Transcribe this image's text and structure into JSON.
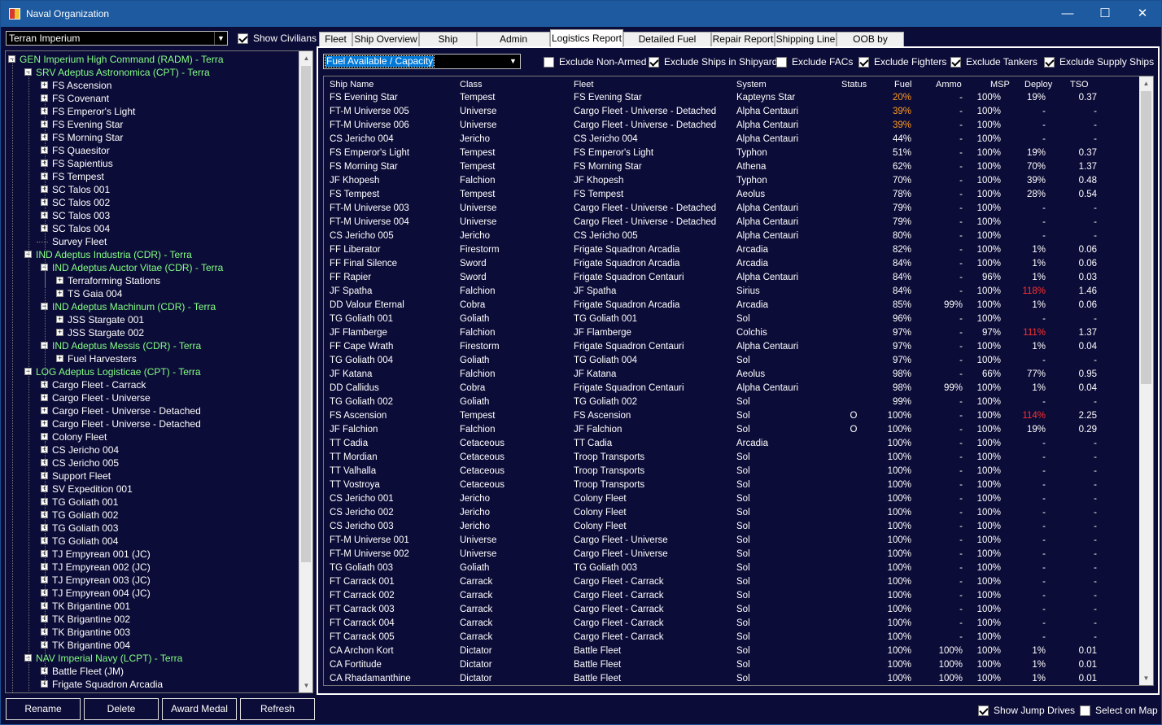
{
  "window": {
    "title": "Naval Organization",
    "minimize": "—",
    "maximize": "☐",
    "close": "✕"
  },
  "left": {
    "empire": "Terran Imperium",
    "show_civilians": {
      "label": "Show Civilians",
      "checked": true
    },
    "tree": [
      {
        "label": "GEN Imperium High Command  (RADM)  -  Terra",
        "lvl": 0,
        "green": true,
        "exp": "-"
      },
      {
        "label": "SRV Adeptus Astronomica  (CPT)  -  Terra",
        "lvl": 1,
        "green": true,
        "exp": "-"
      },
      {
        "label": "FS Ascension",
        "lvl": 2,
        "exp": "+"
      },
      {
        "label": "FS Covenant",
        "lvl": 2,
        "exp": "+"
      },
      {
        "label": "FS Emperor's Light",
        "lvl": 2,
        "exp": "+"
      },
      {
        "label": "FS Evening Star",
        "lvl": 2,
        "exp": "+"
      },
      {
        "label": "FS Morning Star",
        "lvl": 2,
        "exp": "+"
      },
      {
        "label": "FS Quaesitor",
        "lvl": 2,
        "exp": "+"
      },
      {
        "label": "FS Sapientius",
        "lvl": 2,
        "exp": "+"
      },
      {
        "label": "FS Tempest",
        "lvl": 2,
        "exp": "+"
      },
      {
        "label": "SC Talos 001",
        "lvl": 2,
        "exp": "+"
      },
      {
        "label": "SC Talos 002",
        "lvl": 2,
        "exp": "+"
      },
      {
        "label": "SC Talos 003",
        "lvl": 2,
        "exp": "+"
      },
      {
        "label": "SC Talos 004",
        "lvl": 2,
        "exp": "+"
      },
      {
        "label": "Survey Fleet",
        "lvl": 2,
        "exp": ""
      },
      {
        "label": "IND Adeptus Industria  (CDR)  -  Terra",
        "lvl": 1,
        "green": true,
        "exp": "-"
      },
      {
        "label": "IND Adeptus Auctor Vitae  (CDR)  -  Terra",
        "lvl": 2,
        "green": true,
        "exp": "-"
      },
      {
        "label": "Terraforming Stations",
        "lvl": 3,
        "exp": "+"
      },
      {
        "label": "TS Gaia 004",
        "lvl": 3,
        "exp": "+"
      },
      {
        "label": "IND Adeptus Machinum  (CDR)  -  Terra",
        "lvl": 2,
        "green": true,
        "exp": "-"
      },
      {
        "label": "JSS Stargate 001",
        "lvl": 3,
        "exp": "+"
      },
      {
        "label": "JSS Stargate 002",
        "lvl": 3,
        "exp": "+"
      },
      {
        "label": "IND Adeptus Messis  (CDR)  -  Terra",
        "lvl": 2,
        "green": true,
        "exp": "-"
      },
      {
        "label": "Fuel Harvesters",
        "lvl": 3,
        "exp": "+"
      },
      {
        "label": "LOG Adeptus Logisticae  (CPT)  -  Terra",
        "lvl": 1,
        "green": true,
        "exp": "-"
      },
      {
        "label": "Cargo Fleet - Carrack",
        "lvl": 2,
        "exp": "+"
      },
      {
        "label": "Cargo Fleet - Universe",
        "lvl": 2,
        "exp": "+"
      },
      {
        "label": "Cargo Fleet - Universe - Detached",
        "lvl": 2,
        "exp": "+"
      },
      {
        "label": "Cargo Fleet - Universe - Detached",
        "lvl": 2,
        "exp": "+"
      },
      {
        "label": "Colony Fleet",
        "lvl": 2,
        "exp": "+"
      },
      {
        "label": "CS Jericho 004",
        "lvl": 2,
        "exp": "+"
      },
      {
        "label": "CS Jericho 005",
        "lvl": 2,
        "exp": "+"
      },
      {
        "label": "Support Fleet",
        "lvl": 2,
        "exp": "+"
      },
      {
        "label": "SV Expedition 001",
        "lvl": 2,
        "exp": "+"
      },
      {
        "label": "TG Goliath 001",
        "lvl": 2,
        "exp": "+"
      },
      {
        "label": "TG Goliath 002",
        "lvl": 2,
        "exp": "+"
      },
      {
        "label": "TG Goliath 003",
        "lvl": 2,
        "exp": "+"
      },
      {
        "label": "TG Goliath 004",
        "lvl": 2,
        "exp": "+"
      },
      {
        "label": "TJ Empyrean 001  (JC)",
        "lvl": 2,
        "exp": "+"
      },
      {
        "label": "TJ Empyrean 002  (JC)",
        "lvl": 2,
        "exp": "+"
      },
      {
        "label": "TJ Empyrean 003  (JC)",
        "lvl": 2,
        "exp": "+"
      },
      {
        "label": "TJ Empyrean 004  (JC)",
        "lvl": 2,
        "exp": "+"
      },
      {
        "label": "TK Brigantine 001",
        "lvl": 2,
        "exp": "+"
      },
      {
        "label": "TK Brigantine 002",
        "lvl": 2,
        "exp": "+"
      },
      {
        "label": "TK Brigantine 003",
        "lvl": 2,
        "exp": "+"
      },
      {
        "label": "TK Brigantine 004",
        "lvl": 2,
        "exp": "+"
      },
      {
        "label": "NAV Imperial Navy  (LCPT)  -  Terra",
        "lvl": 1,
        "green": true,
        "exp": "-"
      },
      {
        "label": "Battle Fleet  (JM)",
        "lvl": 2,
        "exp": "+"
      },
      {
        "label": "Frigate Squadron Arcadia",
        "lvl": 2,
        "exp": "+"
      }
    ],
    "buttons": {
      "rename": "Rename",
      "delete": "Delete",
      "award": "Award Medal",
      "refresh": "Refresh"
    }
  },
  "tabs": [
    "Fleet",
    "Ship Overview",
    "Ship Combat",
    "Admin Command",
    "Logistics Report",
    "Detailed Fuel Report",
    "Repair Report",
    "Shipping Line",
    "OOB by System"
  ],
  "active_tab": "Logistics Report",
  "report": {
    "mode": "Fuel Available / Capacity",
    "filters": [
      {
        "label": "Exclude Non-Armed",
        "checked": false
      },
      {
        "label": "Exclude Ships in Shipyard",
        "checked": true
      },
      {
        "label": "Exclude FACs",
        "checked": false
      },
      {
        "label": "Exclude Fighters",
        "checked": true
      },
      {
        "label": "Exclude Tankers",
        "checked": true
      },
      {
        "label": "Exclude Supply Ships",
        "checked": true
      }
    ],
    "columns": [
      "Ship Name",
      "Class",
      "Fleet",
      "System",
      "Status",
      "Fuel",
      "Ammo",
      "MSP",
      "Deploy",
      "TSO"
    ],
    "rows": [
      [
        "FS Evening Star",
        "Tempest",
        "FS Evening Star",
        "Kapteyns Star",
        "",
        "20%",
        "-",
        "100%",
        "19%",
        "0.37"
      ],
      [
        "FT-M Universe 005",
        "Universe",
        "Cargo Fleet - Universe - Detached",
        "Alpha Centauri",
        "",
        "39%",
        "-",
        "100%",
        "-",
        "-"
      ],
      [
        "FT-M Universe 006",
        "Universe",
        "Cargo Fleet - Universe - Detached",
        "Alpha Centauri",
        "",
        "39%",
        "-",
        "100%",
        "-",
        "-"
      ],
      [
        "CS Jericho 004",
        "Jericho",
        "CS Jericho 004",
        "Alpha Centauri",
        "",
        "44%",
        "-",
        "100%",
        "-",
        "-"
      ],
      [
        "FS Emperor's Light",
        "Tempest",
        "FS Emperor's Light",
        "Typhon",
        "",
        "51%",
        "-",
        "100%",
        "19%",
        "0.37"
      ],
      [
        "FS Morning Star",
        "Tempest",
        "FS Morning Star",
        "Athena",
        "",
        "62%",
        "-",
        "100%",
        "70%",
        "1.37"
      ],
      [
        "JF Khopesh",
        "Falchion",
        "JF Khopesh",
        "Typhon",
        "",
        "70%",
        "-",
        "100%",
        "39%",
        "0.48"
      ],
      [
        "FS Tempest",
        "Tempest",
        "FS Tempest",
        "Aeolus",
        "",
        "78%",
        "-",
        "100%",
        "28%",
        "0.54"
      ],
      [
        "FT-M Universe 003",
        "Universe",
        "Cargo Fleet - Universe - Detached",
        "Alpha Centauri",
        "",
        "79%",
        "-",
        "100%",
        "-",
        "-"
      ],
      [
        "FT-M Universe 004",
        "Universe",
        "Cargo Fleet - Universe - Detached",
        "Alpha Centauri",
        "",
        "79%",
        "-",
        "100%",
        "-",
        "-"
      ],
      [
        "CS Jericho 005",
        "Jericho",
        "CS Jericho 005",
        "Alpha Centauri",
        "",
        "80%",
        "-",
        "100%",
        "-",
        "-"
      ],
      [
        "FF Liberator",
        "Firestorm",
        "Frigate Squadron Arcadia",
        "Arcadia",
        "",
        "82%",
        "-",
        "100%",
        "1%",
        "0.06"
      ],
      [
        "FF Final Silence",
        "Sword",
        "Frigate Squadron Arcadia",
        "Arcadia",
        "",
        "84%",
        "-",
        "100%",
        "1%",
        "0.06"
      ],
      [
        "FF Rapier",
        "Sword",
        "Frigate Squadron Centauri",
        "Alpha Centauri",
        "",
        "84%",
        "-",
        "96%",
        "1%",
        "0.03"
      ],
      [
        "JF Spatha",
        "Falchion",
        "JF Spatha",
        "Sirius",
        "",
        "84%",
        "-",
        "100%",
        "118%",
        "1.46"
      ],
      [
        "DD Valour Eternal",
        "Cobra",
        "Frigate Squadron Arcadia",
        "Arcadia",
        "",
        "85%",
        "99%",
        "100%",
        "1%",
        "0.06"
      ],
      [
        "TG Goliath 001",
        "Goliath",
        "TG Goliath 001",
        "Sol",
        "",
        "96%",
        "-",
        "100%",
        "-",
        "-"
      ],
      [
        "JF Flamberge",
        "Falchion",
        "JF Flamberge",
        "Colchis",
        "",
        "97%",
        "-",
        "97%",
        "111%",
        "1.37"
      ],
      [
        "FF Cape Wrath",
        "Firestorm",
        "Frigate Squadron Centauri",
        "Alpha Centauri",
        "",
        "97%",
        "-",
        "100%",
        "1%",
        "0.04"
      ],
      [
        "TG Goliath 004",
        "Goliath",
        "TG Goliath 004",
        "Sol",
        "",
        "97%",
        "-",
        "100%",
        "-",
        "-"
      ],
      [
        "JF Katana",
        "Falchion",
        "JF Katana",
        "Aeolus",
        "",
        "98%",
        "-",
        "66%",
        "77%",
        "0.95"
      ],
      [
        "DD Callidus",
        "Cobra",
        "Frigate Squadron Centauri",
        "Alpha Centauri",
        "",
        "98%",
        "99%",
        "100%",
        "1%",
        "0.04"
      ],
      [
        "TG Goliath 002",
        "Goliath",
        "TG Goliath 002",
        "Sol",
        "",
        "99%",
        "-",
        "100%",
        "-",
        "-"
      ],
      [
        "FS Ascension",
        "Tempest",
        "FS Ascension",
        "Sol",
        "O",
        "100%",
        "-",
        "100%",
        "114%",
        "2.25"
      ],
      [
        "JF Falchion",
        "Falchion",
        "JF Falchion",
        "Sol",
        "O",
        "100%",
        "-",
        "100%",
        "19%",
        "0.29"
      ],
      [
        "TT Cadia",
        "Cetaceous",
        "TT Cadia",
        "Arcadia",
        "",
        "100%",
        "-",
        "100%",
        "-",
        "-"
      ],
      [
        "TT Mordian",
        "Cetaceous",
        "Troop Transports",
        "Sol",
        "",
        "100%",
        "-",
        "100%",
        "-",
        "-"
      ],
      [
        "TT Valhalla",
        "Cetaceous",
        "Troop Transports",
        "Sol",
        "",
        "100%",
        "-",
        "100%",
        "-",
        "-"
      ],
      [
        "TT Vostroya",
        "Cetaceous",
        "Troop Transports",
        "Sol",
        "",
        "100%",
        "-",
        "100%",
        "-",
        "-"
      ],
      [
        "CS Jericho 001",
        "Jericho",
        "Colony Fleet",
        "Sol",
        "",
        "100%",
        "-",
        "100%",
        "-",
        "-"
      ],
      [
        "CS Jericho 002",
        "Jericho",
        "Colony Fleet",
        "Sol",
        "",
        "100%",
        "-",
        "100%",
        "-",
        "-"
      ],
      [
        "CS Jericho 003",
        "Jericho",
        "Colony Fleet",
        "Sol",
        "",
        "100%",
        "-",
        "100%",
        "-",
        "-"
      ],
      [
        "FT-M Universe 001",
        "Universe",
        "Cargo Fleet - Universe",
        "Sol",
        "",
        "100%",
        "-",
        "100%",
        "-",
        "-"
      ],
      [
        "FT-M Universe 002",
        "Universe",
        "Cargo Fleet - Universe",
        "Sol",
        "",
        "100%",
        "-",
        "100%",
        "-",
        "-"
      ],
      [
        "TG Goliath 003",
        "Goliath",
        "TG Goliath 003",
        "Sol",
        "",
        "100%",
        "-",
        "100%",
        "-",
        "-"
      ],
      [
        "FT Carrack 001",
        "Carrack",
        "Cargo Fleet - Carrack",
        "Sol",
        "",
        "100%",
        "-",
        "100%",
        "-",
        "-"
      ],
      [
        "FT Carrack 002",
        "Carrack",
        "Cargo Fleet - Carrack",
        "Sol",
        "",
        "100%",
        "-",
        "100%",
        "-",
        "-"
      ],
      [
        "FT Carrack 003",
        "Carrack",
        "Cargo Fleet - Carrack",
        "Sol",
        "",
        "100%",
        "-",
        "100%",
        "-",
        "-"
      ],
      [
        "FT Carrack 004",
        "Carrack",
        "Cargo Fleet - Carrack",
        "Sol",
        "",
        "100%",
        "-",
        "100%",
        "-",
        "-"
      ],
      [
        "FT Carrack 005",
        "Carrack",
        "Cargo Fleet - Carrack",
        "Sol",
        "",
        "100%",
        "-",
        "100%",
        "-",
        "-"
      ],
      [
        "CA Archon Kort",
        "Dictator",
        "Battle Fleet",
        "Sol",
        "",
        "100%",
        "100%",
        "100%",
        "1%",
        "0.01"
      ],
      [
        "CA Fortitude",
        "Dictator",
        "Battle Fleet",
        "Sol",
        "",
        "100%",
        "100%",
        "100%",
        "1%",
        "0.01"
      ],
      [
        "CA Rhadamanthine",
        "Dictator",
        "Battle Fleet",
        "Sol",
        "",
        "100%",
        "100%",
        "100%",
        "1%",
        "0.01"
      ]
    ],
    "highlight": {
      "fuel_low": [
        "20%",
        "39%"
      ],
      "deploy_over": [
        "118%",
        "111%",
        "114%"
      ]
    },
    "colors": {
      "warn": "#ff9c1f",
      "over": "#ff3030",
      "tree_green": "#85ff85"
    }
  },
  "bottom": {
    "show_jump_drives": {
      "label": "Show Jump Drives",
      "checked": true
    },
    "select_on_map": {
      "label": "Select on Map",
      "checked": false
    }
  }
}
